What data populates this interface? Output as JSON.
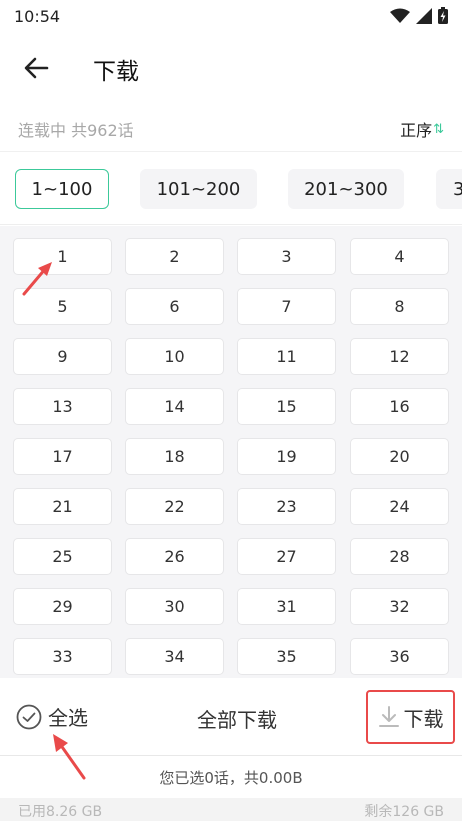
{
  "status_bar": {
    "time": "10:54",
    "icons": [
      "wifi-icon",
      "signal-icon",
      "battery-charging-icon"
    ]
  },
  "header": {
    "back_icon": "arrow-left-icon",
    "title": "下载"
  },
  "info": {
    "serial_status": "连载中 共962话",
    "sort_label": "正序"
  },
  "range_tabs": [
    {
      "label": "1~100",
      "active": true
    },
    {
      "label": "101~200",
      "active": false
    },
    {
      "label": "201~300",
      "active": false
    },
    {
      "label": "3",
      "active": false
    }
  ],
  "chapters": [
    "1",
    "2",
    "3",
    "4",
    "5",
    "6",
    "7",
    "8",
    "9",
    "10",
    "11",
    "12",
    "13",
    "14",
    "15",
    "16",
    "17",
    "18",
    "19",
    "20",
    "21",
    "22",
    "23",
    "24",
    "25",
    "26",
    "27",
    "28",
    "29",
    "30",
    "31",
    "32",
    "33",
    "34",
    "35",
    "36"
  ],
  "actions": {
    "select_all": "全选",
    "download_all": "全部下载",
    "download": "下载"
  },
  "summary": "您已选0话，共0.00B",
  "storage": {
    "used": "已用8.26 GB",
    "free": "剩余126 GB"
  },
  "colors": {
    "accent": "#3cc99a",
    "highlight": "#e94a4a",
    "grid_bg": "#f5f5f7"
  }
}
